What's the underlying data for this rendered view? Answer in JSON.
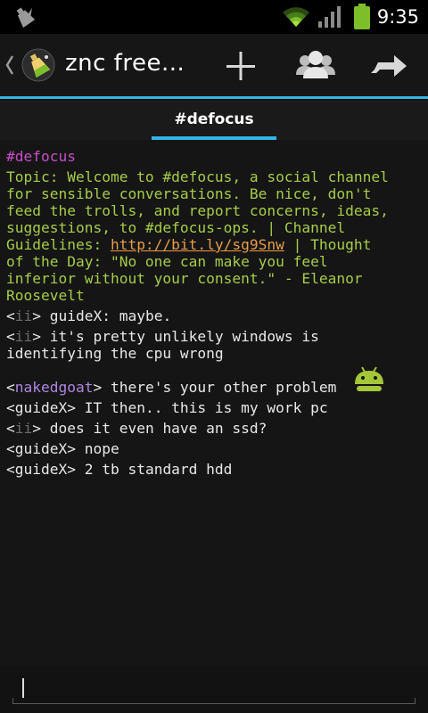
{
  "status_bar": {
    "time": "9:35",
    "icons": [
      "notification-icon",
      "wifi-icon",
      "signal-icon",
      "battery-icon"
    ]
  },
  "action_bar": {
    "title": "znc free...",
    "actions": [
      "add-icon",
      "users-icon",
      "forward-icon"
    ]
  },
  "tabs": [
    {
      "label": "#defocus",
      "selected": true
    }
  ],
  "chat": {
    "channel": "#defocus",
    "topic_line_1": "Topic: Welcome to #defocus, a social channel",
    "topic_line_2": "for sensible conversations. Be nice, don't",
    "topic_line_3": "feed the trolls, and report concerns, ideas,",
    "topic_line_4": "suggestions, to #defocus-ops. | Channel",
    "topic_line_5_prefix": "Guidelines: ",
    "topic_link": "http://bit.ly/sg9Snw",
    "topic_line_5_suffix": " | Thought",
    "topic_line_6": "of the Day: \"No one can make you feel",
    "topic_line_7": "inferior without your consent.\" - Eleanor",
    "topic_line_8": "Roosevelt",
    "messages": [
      {
        "nick": "ii",
        "text": " guideX: maybe."
      },
      {
        "nick": "ii",
        "text": " it's pretty unlikely windows is",
        "text_cont": "identifying the cpu wrong"
      },
      {
        "nick": "nakedgoat",
        "text": " there's your other problem",
        "emoji": "android-icon"
      },
      {
        "nick": "guideX",
        "text": " IT then.. this is my work pc"
      },
      {
        "nick": "ii",
        "text": " does it even have an ssd?"
      },
      {
        "nick": "guideX",
        "text": " nope"
      },
      {
        "nick": "guideX",
        "text": " 2 tb standard hdd"
      }
    ],
    "colors": {
      "channel": "#c84ec8",
      "topic": "#a6cc4a",
      "link": "#e89c4a",
      "nick_ii": "#6a6a6a",
      "nick_nakedgoat": "#b085e0",
      "accent": "#33b5e5"
    }
  },
  "input": {
    "value": ""
  }
}
